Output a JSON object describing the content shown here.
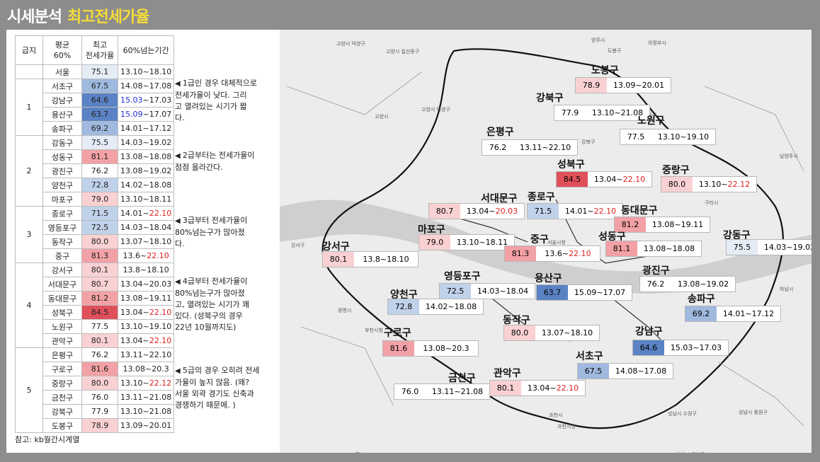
{
  "title": {
    "main": "시세분석",
    "sub": "최고전세가율"
  },
  "table": {
    "headers": [
      "급지",
      "평균\n60%",
      "최고\n전세가율",
      "60%넘는기간"
    ],
    "seoul": {
      "name": "서울",
      "value": "75.1",
      "period": "13.10~18.10"
    },
    "grades": [
      {
        "grade": "1",
        "rows": [
          {
            "name": "서초구",
            "value": "67.5",
            "period": [
              "14.08~17.08"
            ]
          },
          {
            "name": "강남구",
            "value": "64.6",
            "period": [
              "15.03",
              "~17.03"
            ]
          },
          {
            "name": "용산구",
            "value": "63.7",
            "period": [
              "15.09",
              "~17.07"
            ]
          },
          {
            "name": "송파구",
            "value": "69.2",
            "period": [
              "14.01~17.12"
            ]
          }
        ]
      },
      {
        "grade": "2",
        "rows": [
          {
            "name": "강동구",
            "value": "75.5",
            "period": [
              "14.03~19.02"
            ]
          },
          {
            "name": "성동구",
            "value": "81.1",
            "period": [
              "13.08~18.08"
            ]
          },
          {
            "name": "광진구",
            "value": "76.2",
            "period": [
              "13.08~19.02"
            ]
          },
          {
            "name": "양천구",
            "value": "72.8",
            "period": [
              "14.02~18.08"
            ]
          },
          {
            "name": "마포구",
            "value": "79.0",
            "period": [
              "13.10~18.11"
            ]
          }
        ]
      },
      {
        "grade": "3",
        "rows": [
          {
            "name": "종로구",
            "value": "71.5",
            "period": [
              "14.01~",
              "22.10"
            ]
          },
          {
            "name": "영등포구",
            "value": "72.5",
            "period": [
              "14.03~18.04"
            ]
          },
          {
            "name": "동작구",
            "value": "80.0",
            "period": [
              "13.07~18.10"
            ]
          },
          {
            "name": "중구",
            "value": "81.3",
            "period": [
              "13.6~",
              "22.10"
            ]
          }
        ]
      },
      {
        "grade": "4",
        "rows": [
          {
            "name": "강서구",
            "value": "80.1",
            "period": [
              "13.8~18.10"
            ]
          },
          {
            "name": "서대문구",
            "value": "80.7",
            "period": [
              "13.04~20.03"
            ]
          },
          {
            "name": "동대문구",
            "value": "81.2",
            "period": [
              "13.08~19.11"
            ]
          },
          {
            "name": "성북구",
            "value": "84.5",
            "period": [
              "13.04~",
              "22.10"
            ]
          },
          {
            "name": "노원구",
            "value": "77.5",
            "period": [
              "13.10~19.10"
            ]
          },
          {
            "name": "관악구",
            "value": "80.1",
            "period": [
              "13.04~",
              "22.10"
            ]
          }
        ]
      },
      {
        "grade": "5",
        "rows": [
          {
            "name": "은평구",
            "value": "76.2",
            "period": [
              "13.11~22.10"
            ]
          },
          {
            "name": "구로구",
            "value": "81.6",
            "period": [
              "13.08~20.3"
            ]
          },
          {
            "name": "중랑구",
            "value": "80.0",
            "period": [
              "13.10~",
              "22.12"
            ]
          },
          {
            "name": "금천구",
            "value": "76.0",
            "period": [
              "13.11~21.08"
            ]
          },
          {
            "name": "강북구",
            "value": "77.9",
            "period": [
              "13.10~21.08"
            ]
          },
          {
            "name": "도봉구",
            "value": "78.9",
            "period": [
              "13.09~20.01"
            ]
          }
        ]
      }
    ],
    "reference": "참고: kb월간시계열"
  },
  "notes": [
    {
      "arrow": "◀",
      "lines": [
        "1급인 경우 대체적으로",
        "전세가율이 낮다. 그리",
        "고 열려있는 시기가 짧",
        "다."
      ]
    },
    {
      "arrow": "◀",
      "lines": [
        "2급부터는 전세가율이",
        "점점 올라간다."
      ]
    },
    {
      "arrow": "◀",
      "lines": [
        "3급부터 전세가율이",
        "80%넘는구가 많아졌",
        "다."
      ]
    },
    {
      "arrow": "◀",
      "lines": [
        "4급부터 전세가율이",
        "80%넘는구가 많아졌",
        "고, 열려있는 시기가 꽤",
        "있다. (성북구의 경우",
        "22년 10월까지도)"
      ]
    },
    {
      "arrow": "◀",
      "lines": [
        "5급의 경우 오히려 전세",
        "가율이 높지 않음. (왜?",
        "서울 외곽 경기도 신축과",
        "경쟁하기 때문에. )"
      ]
    }
  ],
  "map": {
    "districts": [
      {
        "name": "도봉구",
        "value": "78.9",
        "period": [
          "13.09~20.01"
        ]
      },
      {
        "name": "강북구",
        "value": "77.9",
        "period": [
          "13.10~21.08"
        ]
      },
      {
        "name": "노원구",
        "value": "77.5",
        "period": [
          "13.10~19.10"
        ]
      },
      {
        "name": "은평구",
        "value": "76.2",
        "period": [
          "13.11~22.10"
        ]
      },
      {
        "name": "성북구",
        "value": "84.5",
        "period": [
          "13.04~",
          "22.10"
        ]
      },
      {
        "name": "중랑구",
        "value": "80.0",
        "period": [
          "13.10~",
          "22.12"
        ]
      },
      {
        "name": "서대문구",
        "value": "80.7",
        "period": [
          "13.04~",
          "20.03"
        ]
      },
      {
        "name": "종로구",
        "value": "71.5",
        "period": [
          "14.01~",
          "22.10"
        ]
      },
      {
        "name": "동대문구",
        "value": "81.2",
        "period": [
          "13.08~19.11"
        ]
      },
      {
        "name": "마포구",
        "value": "79.0",
        "period": [
          "13.10~18.11"
        ]
      },
      {
        "name": "중구",
        "value": "81.3",
        "period": [
          "13.6~",
          "22.10"
        ]
      },
      {
        "name": "성동구",
        "value": "81.1",
        "period": [
          "13.08~18.08"
        ]
      },
      {
        "name": "강동구",
        "value": "75.5",
        "period": [
          "14.03~19.02"
        ]
      },
      {
        "name": "강서구",
        "value": "80.1",
        "period": [
          "13.8~18.10"
        ]
      },
      {
        "name": "광진구",
        "value": "76.2",
        "period": [
          "13.08~19.02"
        ]
      },
      {
        "name": "영등포구",
        "value": "72.5",
        "period": [
          "14.03~18.04"
        ]
      },
      {
        "name": "용산구",
        "value": "63.7",
        "period": [
          "15.09~17.07"
        ]
      },
      {
        "name": "양천구",
        "value": "72.8",
        "period": [
          "14.02~18.08"
        ]
      },
      {
        "name": "송파구",
        "value": "69.2",
        "period": [
          "14.01~17.12"
        ]
      },
      {
        "name": "동작구",
        "value": "80.0",
        "period": [
          "13.07~18.10"
        ]
      },
      {
        "name": "구로구",
        "value": "81.6",
        "period": [
          "13.08~20.3"
        ]
      },
      {
        "name": "강남구",
        "value": "64.6",
        "period": [
          "15.03~17.03"
        ]
      },
      {
        "name": "서초구",
        "value": "67.5",
        "period": [
          "14.08~17.08"
        ]
      },
      {
        "name": "금천구",
        "value": "76.0",
        "period": [
          "13.11~21.08"
        ]
      },
      {
        "name": "관악구",
        "value": "80.1",
        "period": [
          "13.04~",
          "22.10"
        ]
      }
    ],
    "place_labels": [
      "고양시 덕양구",
      "고양시 일산동구",
      "양주시",
      "의정부시",
      "고양시 덕양구",
      "고양시",
      "남양주시",
      "구리시",
      "광명시",
      "부천시청",
      "과천시",
      "과천시청",
      "성남시 수정구",
      "성남시 중원구",
      "하남시",
      "시흥시",
      "안양시 동안구",
      "강서구",
      "서울시청",
      "강북구",
      "노원구",
      "도봉구"
    ]
  },
  "colors": {
    "title": "#ffffff",
    "title_sub": "#f4dc3a",
    "red_text": "#e02020",
    "blue_text": "#1c2ed6"
  }
}
